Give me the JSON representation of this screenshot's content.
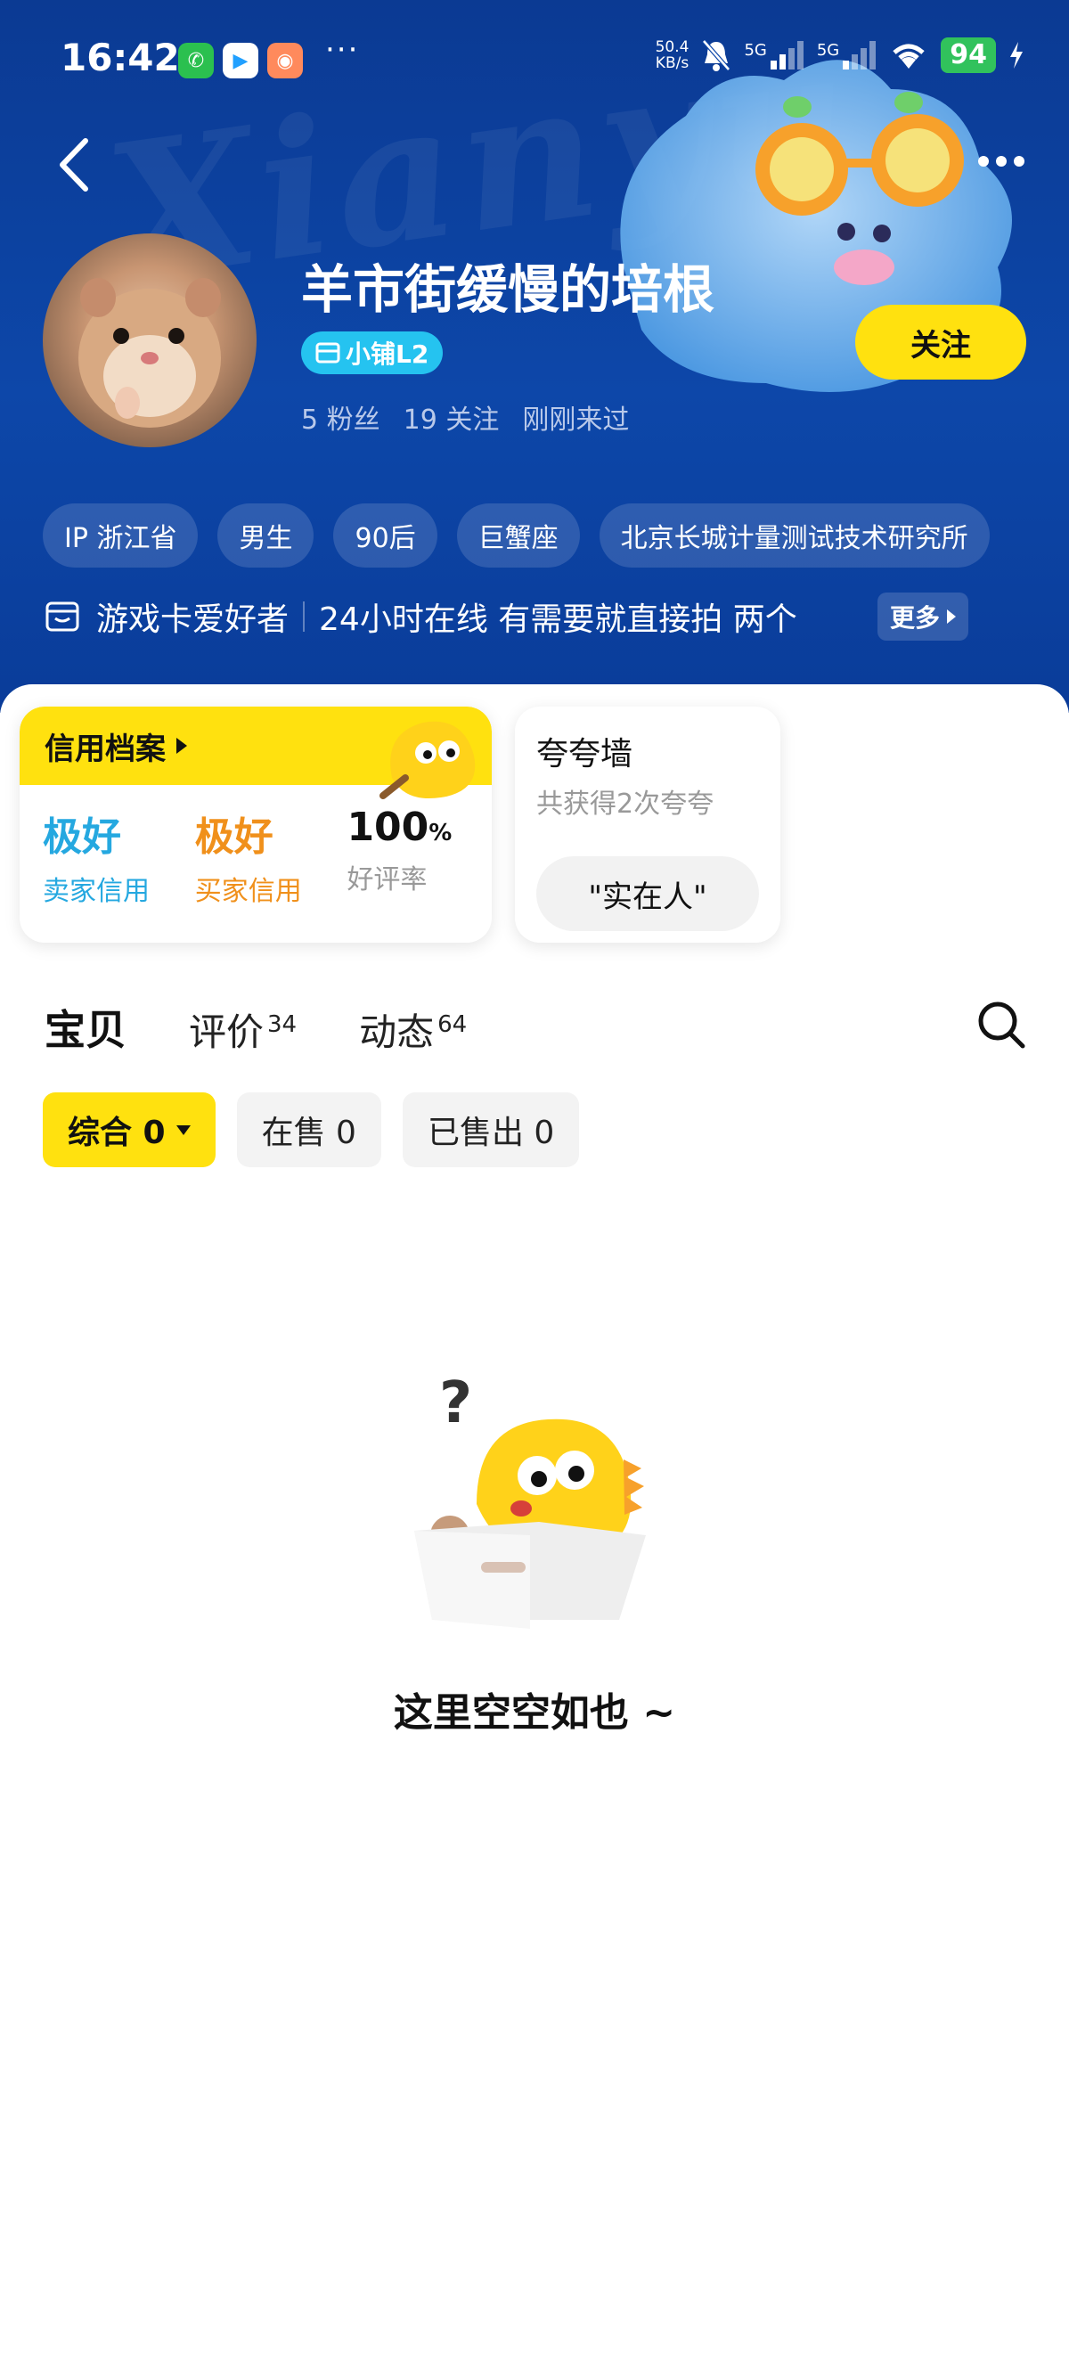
{
  "status_bar": {
    "time": "16:42",
    "net_speed_value": "50.4",
    "net_speed_unit": "KB/s",
    "signal_1": "5G",
    "signal_2": "5G",
    "battery": "94",
    "overflow": "···"
  },
  "header": {
    "back_icon": "chevron-left-icon",
    "menu_icon": "more-dots-icon",
    "watermark": "Xianyu"
  },
  "profile": {
    "username": "羊市街缓慢的培根",
    "badge_icon": "shop-icon",
    "badge_label": "小铺L2",
    "fans": "5 粉丝",
    "following": "19 关注",
    "last_seen": "刚刚来过",
    "follow_button": "关注"
  },
  "tags": [
    "IP 浙江省",
    "男生",
    "90后",
    "巨蟹座",
    "北京长城计量测试技术研究所"
  ],
  "bio": {
    "title": "游戏卡爱好者",
    "text": "24小时在线 有需要就直接拍 两个",
    "more": "更多"
  },
  "credit": {
    "title": "信用档案",
    "items": [
      {
        "value": "极好",
        "label": "卖家信用",
        "color": "#25a8e0"
      },
      {
        "value": "极好",
        "label": "买家信用",
        "color": "#f0901b"
      },
      {
        "value": "100",
        "unit": "%",
        "label": "好评率"
      }
    ]
  },
  "praise": {
    "title": "夸夸墙",
    "subtitle": "共获得2次夸夸",
    "chip": "\"实在人\""
  },
  "tabs": [
    {
      "label": "宝贝",
      "count": ""
    },
    {
      "label": "评价",
      "count": "34"
    },
    {
      "label": "动态",
      "count": "64"
    }
  ],
  "filters": [
    {
      "label": "综合 0"
    },
    {
      "label": "在售 0"
    },
    {
      "label": "已售出 0"
    }
  ],
  "empty_state": {
    "text": "这里空空如也 ~"
  },
  "colors": {
    "brand_yellow": "#ffe10f",
    "header_blue": "#0d47a9",
    "seller_blue": "#25a8e0",
    "buyer_orange": "#f0901b"
  }
}
